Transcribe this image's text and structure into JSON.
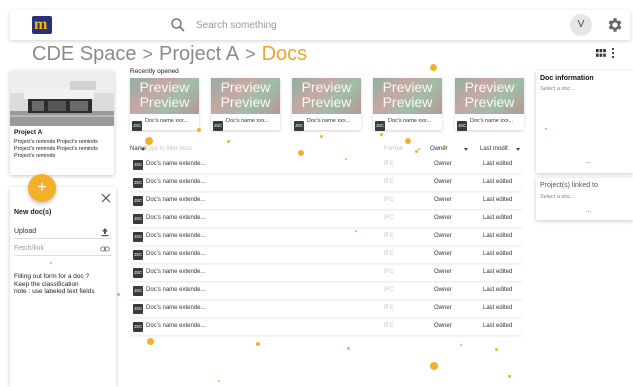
{
  "header": {
    "logo_text": "m",
    "search_placeholder": "Search something",
    "avatar_initial": "V"
  },
  "breadcrumb": [
    "CDE Space",
    "Project A",
    "Docs"
  ],
  "breadcrumb_separator": ">",
  "project": {
    "title": "Project A",
    "description": "Project's reminds Project's reminds Project's reminds Project's reminds Project's reminds"
  },
  "fab_label": "+",
  "new_doc": {
    "title": "New doc(s)",
    "upload_label": "Upload",
    "fetch_label": "Fetch/link",
    "note": "Filling out form for a doc ?\nKeep the classification\nnote : use labeled text fields"
  },
  "recently_opened": {
    "label": "Recently opened",
    "preview_text": "Preview",
    "items": [
      {
        "name": "Doc's name xxx..."
      },
      {
        "name": "Doc's name xxx..."
      },
      {
        "name": "Doc's name xxx..."
      },
      {
        "name": "Doc's name xxx..."
      },
      {
        "name": "Doc's name xxx..."
      }
    ]
  },
  "file_icon_text": "JSC",
  "table": {
    "headers": {
      "name": "Name",
      "filter": "Type to filter docs",
      "format": "Format",
      "owner": "Owner",
      "modified": "Last modif."
    },
    "rows": [
      {
        "name": "Doc's name extende...",
        "format": "IFC",
        "owner": "Owner",
        "modified": "Last edited"
      },
      {
        "name": "Doc's name extende...",
        "format": "IFC",
        "owner": "Owner",
        "modified": "Last edited"
      },
      {
        "name": "Doc's name extende...",
        "format": "IFC",
        "owner": "Owner",
        "modified": "Last edited"
      },
      {
        "name": "Doc's name extende...",
        "format": "IFC",
        "owner": "Owner",
        "modified": "Last edited"
      },
      {
        "name": "Doc's name extende...",
        "format": "IFC",
        "owner": "Owner",
        "modified": "Last edited"
      },
      {
        "name": "Doc's name extende...",
        "format": "IFC",
        "owner": "Owner",
        "modified": "Last edited"
      },
      {
        "name": "Doc's name extende...",
        "format": "IFC",
        "owner": "Owner",
        "modified": "Last edited"
      },
      {
        "name": "Doc's name extende...",
        "format": "IFC",
        "owner": "Owner",
        "modified": "Last edited"
      },
      {
        "name": "Doc's name extende...",
        "format": "IFC",
        "owner": "Owner",
        "modified": "Last edited"
      },
      {
        "name": "Doc's name extende...",
        "format": "IFC",
        "owner": "Owner",
        "modified": "Last edited"
      }
    ]
  },
  "doc_info": {
    "title": "Doc information",
    "subtitle": "Select a doc...",
    "more": "..."
  },
  "linked": {
    "title": "Project(s) linked to",
    "subtitle": "Select a doc...",
    "more": "..."
  },
  "colors": {
    "accent": "#f0a52a",
    "brand_blue": "#2a2f7a",
    "muted_text": "#8b8b8b"
  }
}
